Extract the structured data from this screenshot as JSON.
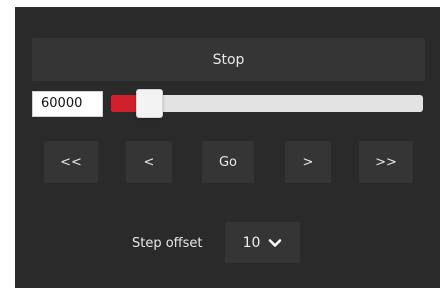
{
  "stop_button": {
    "label": "Stop"
  },
  "position_field": {
    "value": "60000"
  },
  "position_slider": {
    "level": 0.08,
    "fill_color": "#d0202b"
  },
  "navigation": [
    {
      "label": "<<"
    },
    {
      "label": "<"
    },
    {
      "label": "Go"
    },
    {
      "label": ">"
    },
    {
      "label": ">>"
    }
  ],
  "step_offset": {
    "label": "Step offset",
    "selected": "10",
    "icon": "chevron-down-icon"
  }
}
